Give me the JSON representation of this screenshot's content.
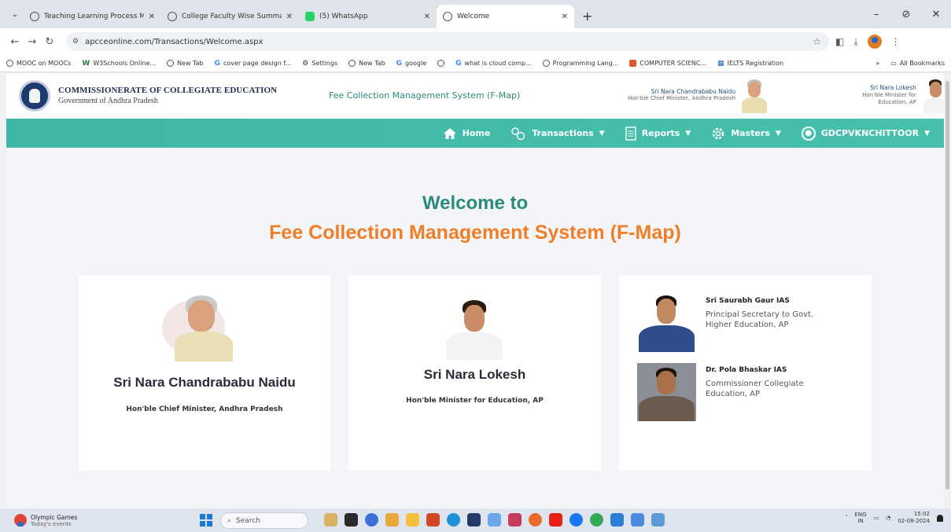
{
  "browser": {
    "tabs": [
      {
        "title": "Teaching Learning Process Mo",
        "active": false,
        "icon": "globe-icon"
      },
      {
        "title": "College Faculty Wise Summary",
        "active": false,
        "icon": "globe-icon"
      },
      {
        "title": "(5) WhatsApp",
        "active": false,
        "icon": "whatsapp-icon"
      },
      {
        "title": "Welcome",
        "active": true,
        "icon": "globe-icon"
      }
    ],
    "url": "apcceonline.com/Transactions/Welcome.aspx",
    "bookmarks": [
      "MOOC on MOOCs",
      "W3Schools Online...",
      "New Tab",
      "cover page design f...",
      "Settings",
      "New Tab",
      "google",
      "",
      "what is cloud comp...",
      "Programming Lang...",
      "COMPUTER SCIENC...",
      "IELTS Registration"
    ],
    "bookmarks_overflow": "»",
    "all_bookmarks": "All Bookmarks"
  },
  "header": {
    "org_name": "COMMISSIONERATE OF COLLEGIATE EDUCATION",
    "org_sub": "Government of Andhra Pradesh",
    "system_title": "Fee Collection Management System (F-Map)",
    "leader1_name": "Sri Nara Chandrababu Naidu",
    "leader1_role": "Hon'ble Chief Minister, Andhra Pradesh",
    "leader2_name": "Sri Nara Lokesh",
    "leader2_role": "Hon'ble Minister for Education, AP"
  },
  "nav": {
    "home": "Home",
    "transactions": "Transactions",
    "reports": "Reports",
    "masters": "Masters",
    "user": "GDCPVKNCHITTOOR",
    "caret": "▼"
  },
  "main": {
    "welcome_line1": "Welcome to",
    "welcome_line2": "Fee Collection Management System (F-Map)",
    "card1": {
      "name": "Sri Nara Chandrababu Naidu",
      "role": "Hon'ble Chief Minister, Andhra Pradesh"
    },
    "card2": {
      "name": "Sri Nara Lokesh",
      "role": "Hon'ble Minister for Education, AP"
    },
    "officials": [
      {
        "name": "Sri Saurabh Gaur IAS",
        "desig1": "Principal Secretary to Govt.",
        "desig2": "Higher Education, AP"
      },
      {
        "name": "Dr. Pola Bhaskar IAS",
        "desig1": "Commissioner Collegiate",
        "desig2": "Education, AP"
      }
    ]
  },
  "taskbar": {
    "news_title": "Olympic Games",
    "news_sub": "Today's events",
    "search_placeholder": "Search",
    "lang1": "ENG",
    "lang2": "IN",
    "time": "15:02",
    "date": "02-08-2024"
  },
  "colors": {
    "teal": "#2a8a7c",
    "orange": "#ef7e27",
    "nav_bg": "#3fb7a5"
  }
}
